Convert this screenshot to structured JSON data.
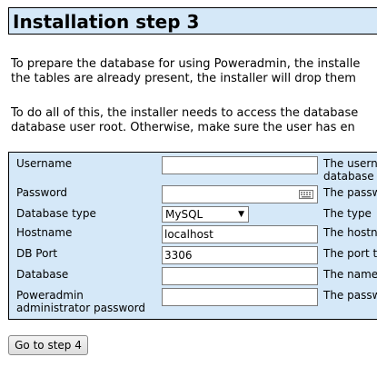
{
  "page": {
    "title": "Installation step 3",
    "intro_lines": [
      "To prepare the database for using Poweradmin, the installe",
      "the tables are already present, the installer will drop them"
    ],
    "access_lines": [
      "To do all of this, the installer needs to access the database",
      "database user root. Otherwise, make sure the user has en"
    ]
  },
  "form": {
    "rows": [
      {
        "label": "Username",
        "value": "",
        "description": [
          "The usern",
          "database"
        ]
      },
      {
        "label": "Password",
        "value": "",
        "description": [
          "The passw"
        ]
      },
      {
        "label": "Database type",
        "value": "MySQL",
        "description": [
          "The type"
        ]
      },
      {
        "label": "Hostname",
        "value": "localhost",
        "description": [
          "The hostn"
        ]
      },
      {
        "label": "DB Port",
        "value": "3306",
        "description": [
          "The port t"
        ]
      },
      {
        "label": "Database",
        "value": "",
        "description": [
          "The name"
        ]
      },
      {
        "label": [
          "Poweradmin",
          "administrator password"
        ],
        "value": "",
        "description": [
          "The passw"
        ]
      }
    ]
  },
  "actions": {
    "next_button": "Go to step 4"
  },
  "icons": {
    "password_field": "keyboard-icon",
    "select": "chevron-down-icon"
  },
  "colors": {
    "panel_background": "#d5e8f8",
    "border": "#000000"
  }
}
